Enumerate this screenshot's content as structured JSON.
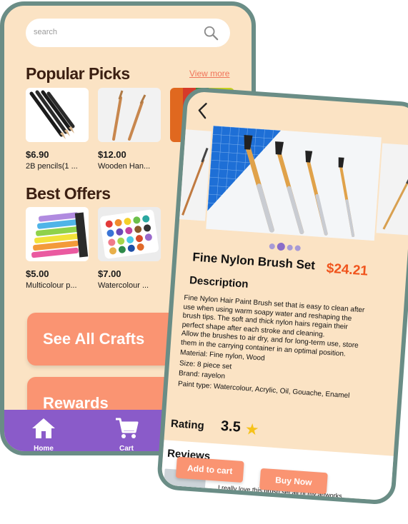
{
  "browse": {
    "search_placeholder": "search",
    "popular": {
      "title": "Popular Picks",
      "view_more": "View more",
      "items": [
        {
          "price": "$6.90",
          "name": "2B pencils(1 ..."
        },
        {
          "price": "$12.00",
          "name": "Wooden Han..."
        }
      ]
    },
    "offers": {
      "title": "Best Offers",
      "items": [
        {
          "price": "$5.00",
          "name": "Multicolour p..."
        },
        {
          "price": "$7.00",
          "name": "Watercolour ..."
        }
      ]
    },
    "see_all": "See All Crafts",
    "rewards": "Rewards",
    "nav": {
      "home": "Home",
      "cart": "Cart"
    }
  },
  "product": {
    "title": "Fine Nylon Brush Set",
    "price": "$24.21",
    "description_title": "Description",
    "description": "Fine Nylon Hair Paint Brush set that is easy to clean after use when using warm soapy water and reshaping the brush tips. The soft and thick nylon hairs regain their perfect shape after each stroke and cleaning.",
    "description2": "Allow the brushes to air dry, and for long-term use, store them in the carrying container in an optimal position.",
    "specs": [
      "Material: Fine nylon, Wood",
      "Size: 8 piece set",
      "Brand: rayelon",
      "Paint type: Watercolour, Acrylic, Oil, Gouache, Enamel"
    ],
    "gallery": {
      "total": 4,
      "active": 2
    },
    "rating_label": "Rating",
    "rating": "3.5",
    "reviews_title": "Reviews",
    "review_text": "I really love this brush set all of my artworks",
    "add_to_cart": "Add to cart",
    "buy_now": "Buy Now"
  },
  "colors": {
    "cream": "#fbe3c4",
    "frame": "#6a8d86",
    "accent": "#fa9472",
    "nav": "#8a5bc9",
    "price": "#f0541c",
    "star": "#f6c21a"
  }
}
